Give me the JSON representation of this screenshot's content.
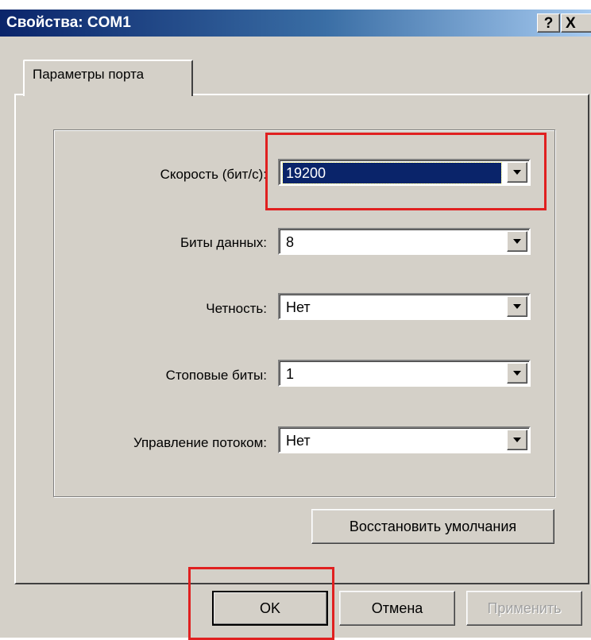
{
  "window": {
    "title": "Свойства: COM1",
    "help_label": "?",
    "close_label": "X"
  },
  "tabs": [
    {
      "label": "Параметры порта",
      "selected": true
    }
  ],
  "fields": [
    {
      "label": "Скорость (бит/с):",
      "value": "19200",
      "focused": true
    },
    {
      "label": "Биты данных:",
      "value": "8"
    },
    {
      "label": "Четность:",
      "value": "Нет"
    },
    {
      "label": "Стоповые биты:",
      "value": "1"
    },
    {
      "label": "Управление потоком:",
      "value": "Нет"
    }
  ],
  "buttons": {
    "restore_defaults": "Восстановить умолчания",
    "ok": "OK",
    "cancel": "Отмена",
    "apply": "Применить"
  },
  "colors": {
    "highlight_box": "#e02020",
    "selection": "#0a246a",
    "face": "#d4d0c8"
  }
}
